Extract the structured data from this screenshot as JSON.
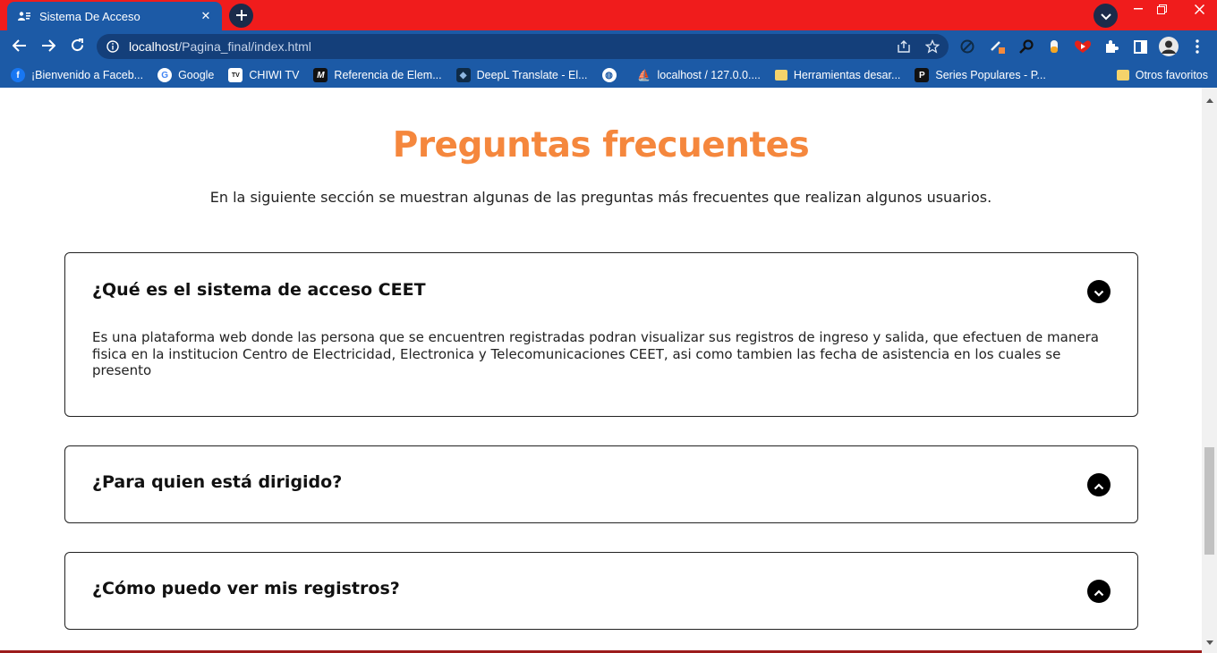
{
  "browser": {
    "tab": {
      "title": "Sistema De Acceso",
      "close": "✕"
    },
    "new_tab": "+",
    "window": {
      "minimize": "—",
      "restore": "❐",
      "close": "✕"
    },
    "url": {
      "host": "localhost",
      "path": "/Pagina_final/index.html"
    },
    "bookmarks": [
      {
        "label": "¡Bienvenido a Faceb...",
        "icon": "facebook-icon",
        "badge": "f",
        "color": "#1877f2"
      },
      {
        "label": "Google",
        "icon": "google-icon",
        "badge": "G",
        "color": "#ffffff"
      },
      {
        "label": "CHIWI TV",
        "icon": "tv-icon",
        "badge": "TV",
        "color": "#ffffff"
      },
      {
        "label": "Referencia de Elem...",
        "icon": "mdn-icon",
        "badge": "M",
        "color": "#111111"
      },
      {
        "label": "DeepL Translate - El...",
        "icon": "deepl-icon",
        "badge": "◆",
        "color": "#0f2b46"
      },
      {
        "label": "",
        "icon": "globe-icon",
        "badge": "◍",
        "color": "#1c5aa6"
      },
      {
        "label": "localhost / 127.0.0....",
        "icon": "phpmyadmin-icon",
        "badge": "⛵",
        "color": "#f6a03c"
      },
      {
        "label": "Herramientas desar...",
        "icon": "folder-icon",
        "badge": "",
        "color": "#f5d36b"
      },
      {
        "label": "Series Populares - P...",
        "icon": "p-icon",
        "badge": "P",
        "color": "#111111"
      }
    ],
    "other_bookmarks": "Otros favoritos"
  },
  "faq": {
    "title": "Preguntas frecuentes",
    "subtitle": "En la siguiente sección se muestran algunas de las preguntas más frecuentes que realizan algunos usuarios.",
    "items": [
      {
        "question": "¿Qué es el sistema de acceso CEET",
        "answer": "Es una plataforma web donde las persona que se encuentren registradas podran visualizar sus registros de ingreso y salida, que efectuen de manera fisica en la institucion Centro de Electricidad, Electronica y Telecomunicaciones CEET, asi como tambien las fecha de asistencia en los cuales se presento",
        "expanded": true
      },
      {
        "question": "¿Para quien está dirigido?",
        "answer": "",
        "expanded": false
      },
      {
        "question": "¿Cómo puedo ver mis registros?",
        "answer": "",
        "expanded": false
      }
    ]
  },
  "colors": {
    "tabbar": "#f01c1c",
    "chrome": "#1c5aa6",
    "accent": "#f5873d"
  }
}
